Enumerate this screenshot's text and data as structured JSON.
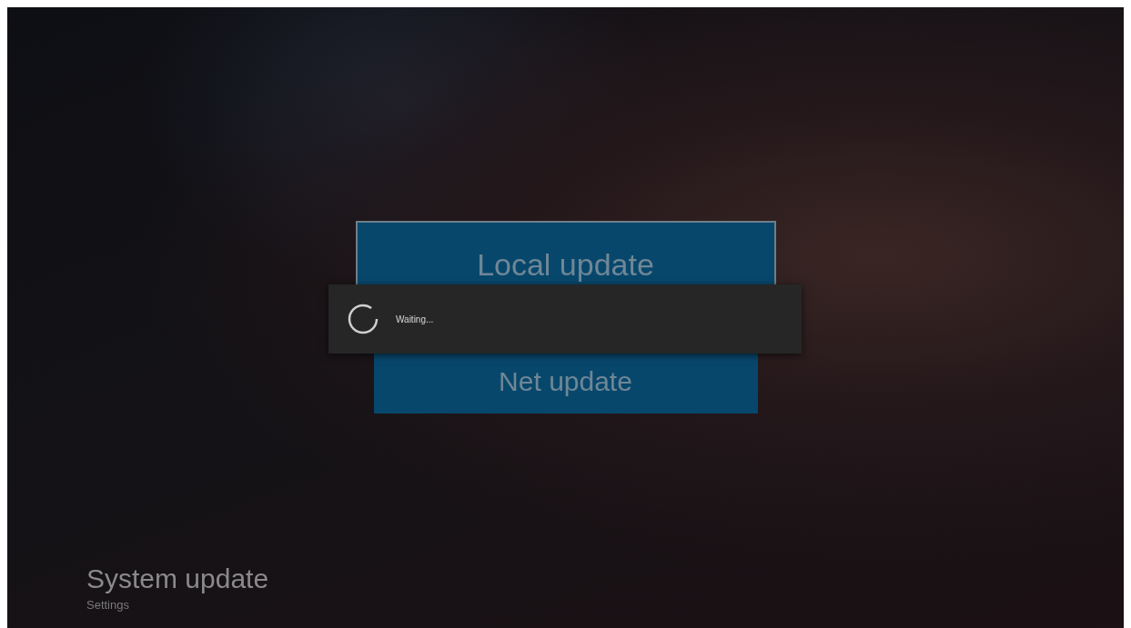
{
  "options": [
    {
      "label": "Local update",
      "selected": true
    },
    {
      "label": "Net update",
      "selected": false
    }
  ],
  "dialog": {
    "message": "Waiting..."
  },
  "footer": {
    "title": "System update",
    "subtitle": "Settings"
  }
}
